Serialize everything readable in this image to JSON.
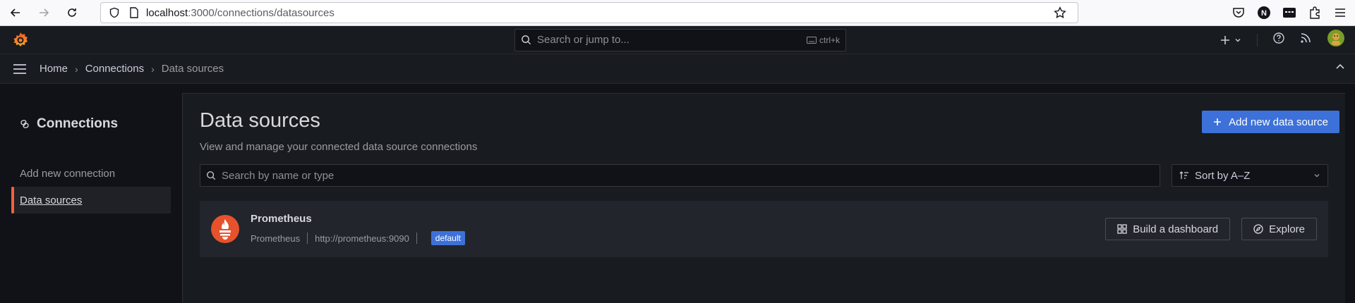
{
  "browser": {
    "url_host": "localhost",
    "url_path": ":3000/connections/datasources",
    "account_initial": "N"
  },
  "topbar": {
    "search_placeholder": "Search or jump to...",
    "shortcut": "ctrl+k"
  },
  "breadcrumb": [
    "Home",
    "Connections",
    "Data sources"
  ],
  "sidenav": {
    "title": "Connections",
    "items": [
      {
        "label": "Add new connection",
        "active": false
      },
      {
        "label": "Data sources",
        "active": true
      }
    ]
  },
  "page": {
    "title": "Data sources",
    "subtitle": "View and manage your connected data source connections",
    "add_button": "Add new data source",
    "search_placeholder": "Search by name or type",
    "sort_label": "Sort by A–Z"
  },
  "datasources": [
    {
      "name": "Prometheus",
      "type": "Prometheus",
      "url": "http://prometheus:9090",
      "badge": "default",
      "actions": [
        "Build a dashboard",
        "Explore"
      ]
    }
  ],
  "colors": {
    "accent": "#3d71d9",
    "brand_orange": "#f55f3e",
    "prometheus": "#e6522c"
  }
}
